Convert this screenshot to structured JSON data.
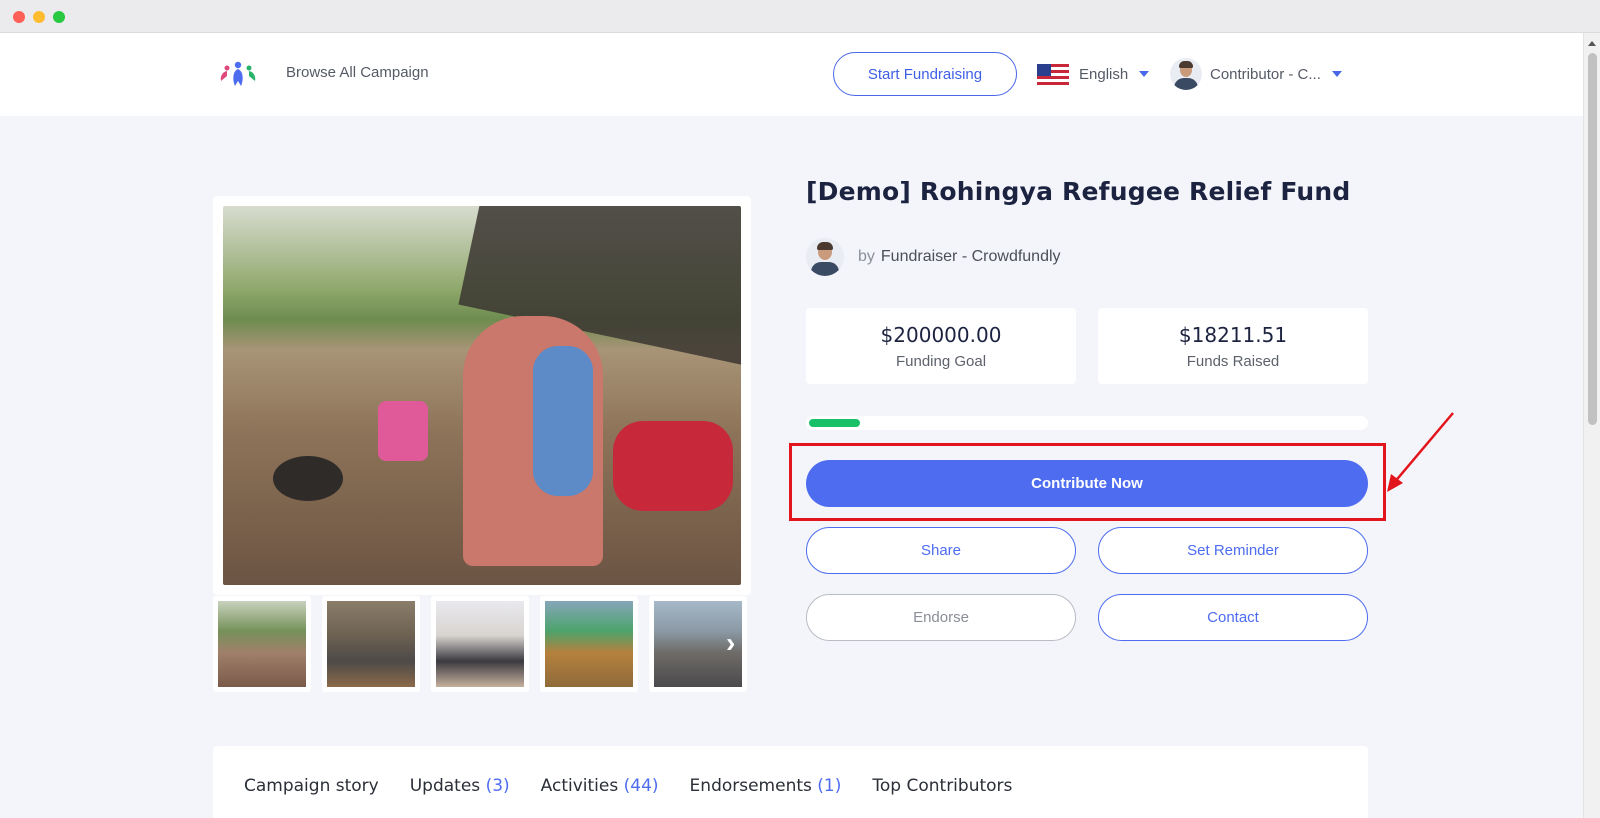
{
  "window": {
    "controls": [
      "close",
      "minimize",
      "maximize"
    ]
  },
  "nav": {
    "logo": "crowdfundly-logo",
    "browse_label": "Browse All Campaign",
    "start_label": "Start Fundraising",
    "language": "English",
    "user": "Contributor - C..."
  },
  "campaign": {
    "title": "[Demo] Rohingya Refugee Relief Fund",
    "by_word": "by",
    "organizer": "Fundraiser - Crowdfundly",
    "goal_value": "$200000.00",
    "goal_label": "Funding Goal",
    "raised_value": "$18211.51",
    "raised_label": "Funds Raised",
    "progress_fraction": 0.091
  },
  "actions": {
    "contribute": "Contribute Now",
    "share": "Share",
    "reminder": "Set Reminder",
    "endorse": "Endorse",
    "contact": "Contact"
  },
  "gallery": {
    "thumbnails": [
      "photo-1",
      "photo-2",
      "photo-3",
      "photo-4",
      "photo-5"
    ],
    "next_icon": "chevron-right-icon"
  },
  "tabs": [
    {
      "label": "Campaign story",
      "count": ""
    },
    {
      "label": "Updates",
      "count": "(3)"
    },
    {
      "label": "Activities",
      "count": "(44)"
    },
    {
      "label": "Endorsements",
      "count": "(1)"
    },
    {
      "label": "Top Contributors",
      "count": ""
    }
  ],
  "colors": {
    "accent": "#4e6cf0",
    "progress": "#18c167",
    "highlight": "#e3151c",
    "background": "#f4f5fa"
  }
}
